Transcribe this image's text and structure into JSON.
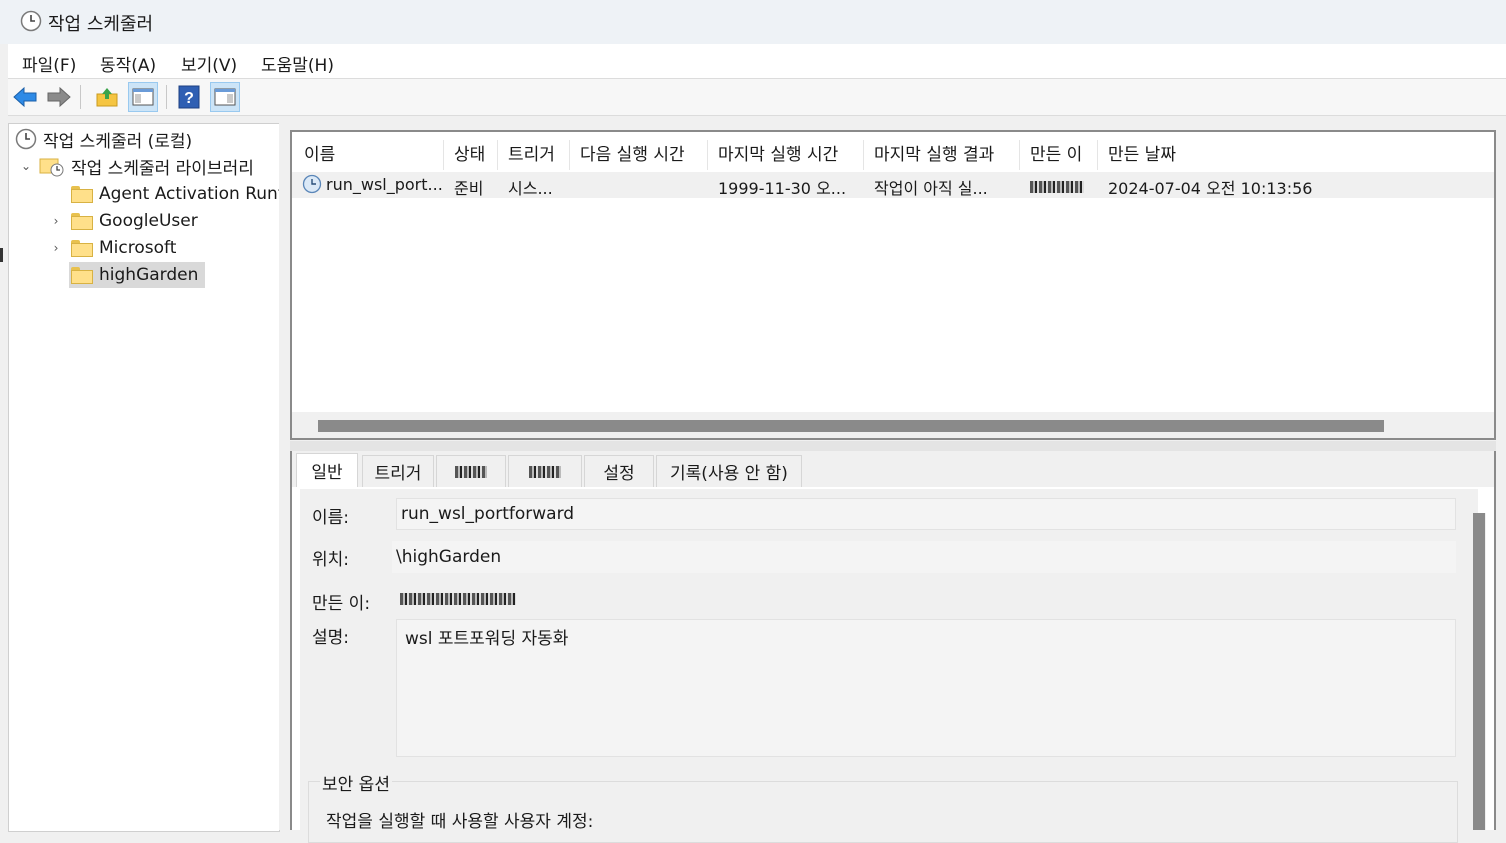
{
  "window": {
    "title": "작업 스케줄러",
    "icon": "clock-icon"
  },
  "menu": [
    "파일(F)",
    "동작(A)",
    "보기(V)",
    "도움말(H)"
  ],
  "toolbar": {
    "buttons": [
      "back-arrow-icon",
      "forward-arrow-icon",
      "up-folder-icon",
      "show-hide-console-tree-icon",
      "help-icon",
      "show-hide-action-pane-icon"
    ]
  },
  "tree": {
    "root": "작업 스케줄러 (로컬)",
    "library": "작업 스케줄러 라이브러리",
    "folders": [
      "Agent Activation Runtime",
      "GoogleUser",
      "Microsoft",
      "highGarden"
    ],
    "selected": "highGarden"
  },
  "task_list": {
    "columns": [
      "이름",
      "상태",
      "트리거",
      "다음 실행 시간",
      "마지막 실행 시간",
      "마지막 실행 결과",
      "만든 이",
      "만든 날짜"
    ],
    "rows": [
      {
        "name": "run_wsl_port...",
        "status": "준비",
        "trigger": "시스...",
        "next_run": "",
        "last_run": "1999-11-30 오...",
        "last_result": "작업이 아직 실...",
        "author": "",
        "created": "2024-07-04 오전 10:13:56"
      }
    ]
  },
  "tabs": [
    "일반",
    "트리거",
    "",
    "",
    "설정",
    "기록(사용 안 함)"
  ],
  "active_tab": "일반",
  "general": {
    "name_label": "이름:",
    "name_value": "run_wsl_portforward",
    "location_label": "위치:",
    "location_value": "\\highGarden",
    "author_label": "만든 이:",
    "description_label": "설명:",
    "description_value": "wsl 포트포워딩 자동화",
    "security_group": "보안 옵션",
    "run_as_label": "작업을 실행할 때 사용할 사용자 계정:"
  },
  "colors": {
    "selection": "#d9d9d9",
    "accent": "#0078d4",
    "scroll_thumb": "#8a8a8a"
  }
}
